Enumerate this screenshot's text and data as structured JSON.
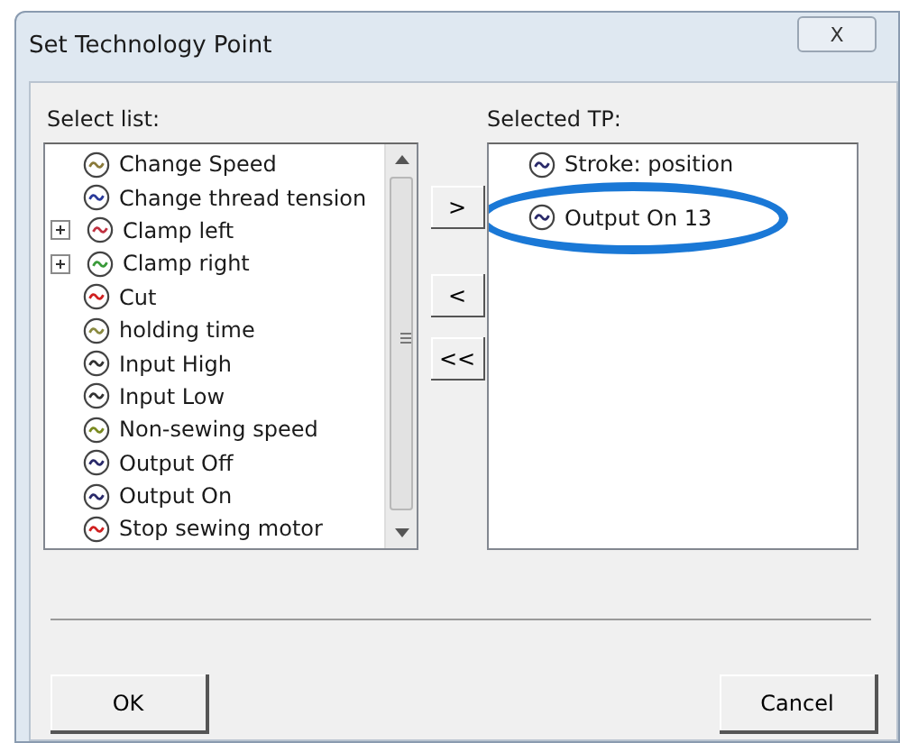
{
  "window": {
    "title": "Set Technology Point",
    "close_label": "X"
  },
  "select_list": {
    "label": "Select list:",
    "items": [
      {
        "text": "Change Speed"
      },
      {
        "text": "Change thread tension"
      },
      {
        "text": "Clamp left",
        "expanded": false
      },
      {
        "text": "Clamp right",
        "expanded": false
      },
      {
        "text": "Cut"
      },
      {
        "text": "holding time"
      },
      {
        "text": "Input High"
      },
      {
        "text": "Input Low"
      },
      {
        "text": "Non-sewing speed"
      },
      {
        "text": "Output Off"
      },
      {
        "text": "Output On"
      },
      {
        "text": "Stop sewing motor"
      }
    ]
  },
  "move_buttons": [
    ">",
    "<",
    "<<"
  ],
  "selected_tp": {
    "label": "Selected TP:",
    "items": [
      {
        "text": "Stroke: position"
      },
      {
        "text": "Output On  13"
      }
    ]
  },
  "buttons": [
    "OK",
    "Cancel"
  ]
}
